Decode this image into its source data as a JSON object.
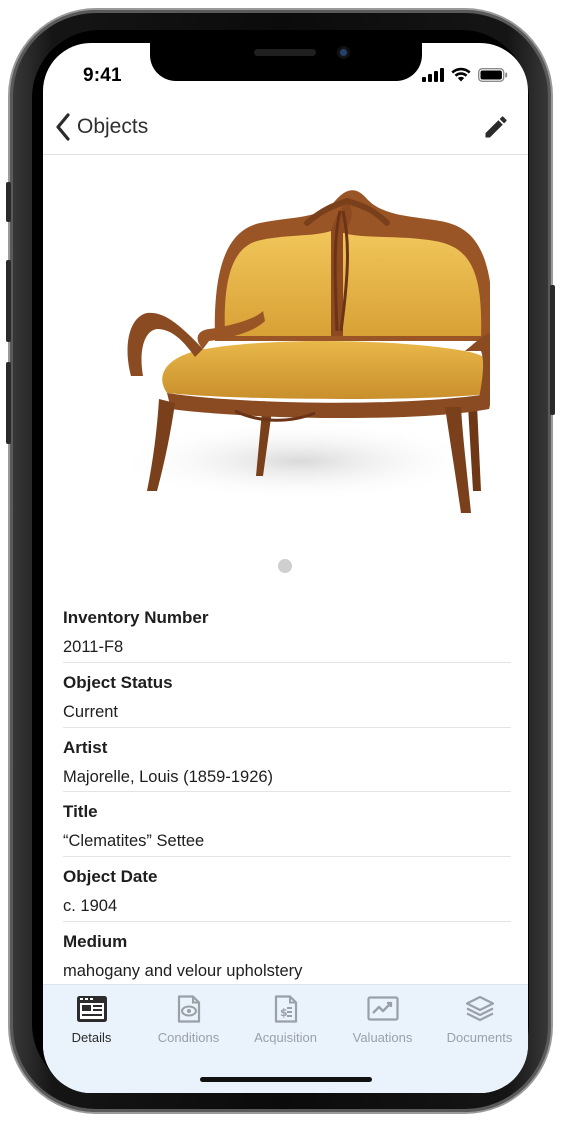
{
  "status_bar": {
    "time": "9:41",
    "icons": [
      "signal-icon",
      "wifi-icon",
      "battery-icon"
    ]
  },
  "nav": {
    "back_label": "Objects",
    "back_icon": "chevron-left-icon",
    "edit_icon": "pencil-icon"
  },
  "gallery": {
    "image": "settee-photo",
    "page_count": 1,
    "current_page": 1
  },
  "fields": [
    {
      "label": "Inventory Number",
      "value": "2011-F8"
    },
    {
      "label": "Object Status",
      "value": "Current"
    },
    {
      "label": "Artist",
      "value": "Majorelle, Louis (1859-1926)"
    },
    {
      "label": "Title",
      "value": "“Clematites” Settee"
    },
    {
      "label": "Object Date",
      "value": "c. 1904"
    },
    {
      "label": "Medium",
      "value": "mahogany and velour upholstery"
    }
  ],
  "tabs": [
    {
      "label": "Details",
      "icon": "details-icon",
      "active": true
    },
    {
      "label": "Conditions",
      "icon": "conditions-icon",
      "active": false
    },
    {
      "label": "Acquisition",
      "icon": "acquisition-icon",
      "active": false
    },
    {
      "label": "Valuations",
      "icon": "valuations-icon",
      "active": false
    },
    {
      "label": "Documents",
      "icon": "documents-icon",
      "active": false
    }
  ],
  "colors": {
    "tab_active": "#2c2c2c",
    "tab_inactive": "#9aa0a8",
    "tab_bar_bg": "#eaf2fb",
    "upholstery": "#e2b347",
    "wood": "#8a4b22"
  }
}
